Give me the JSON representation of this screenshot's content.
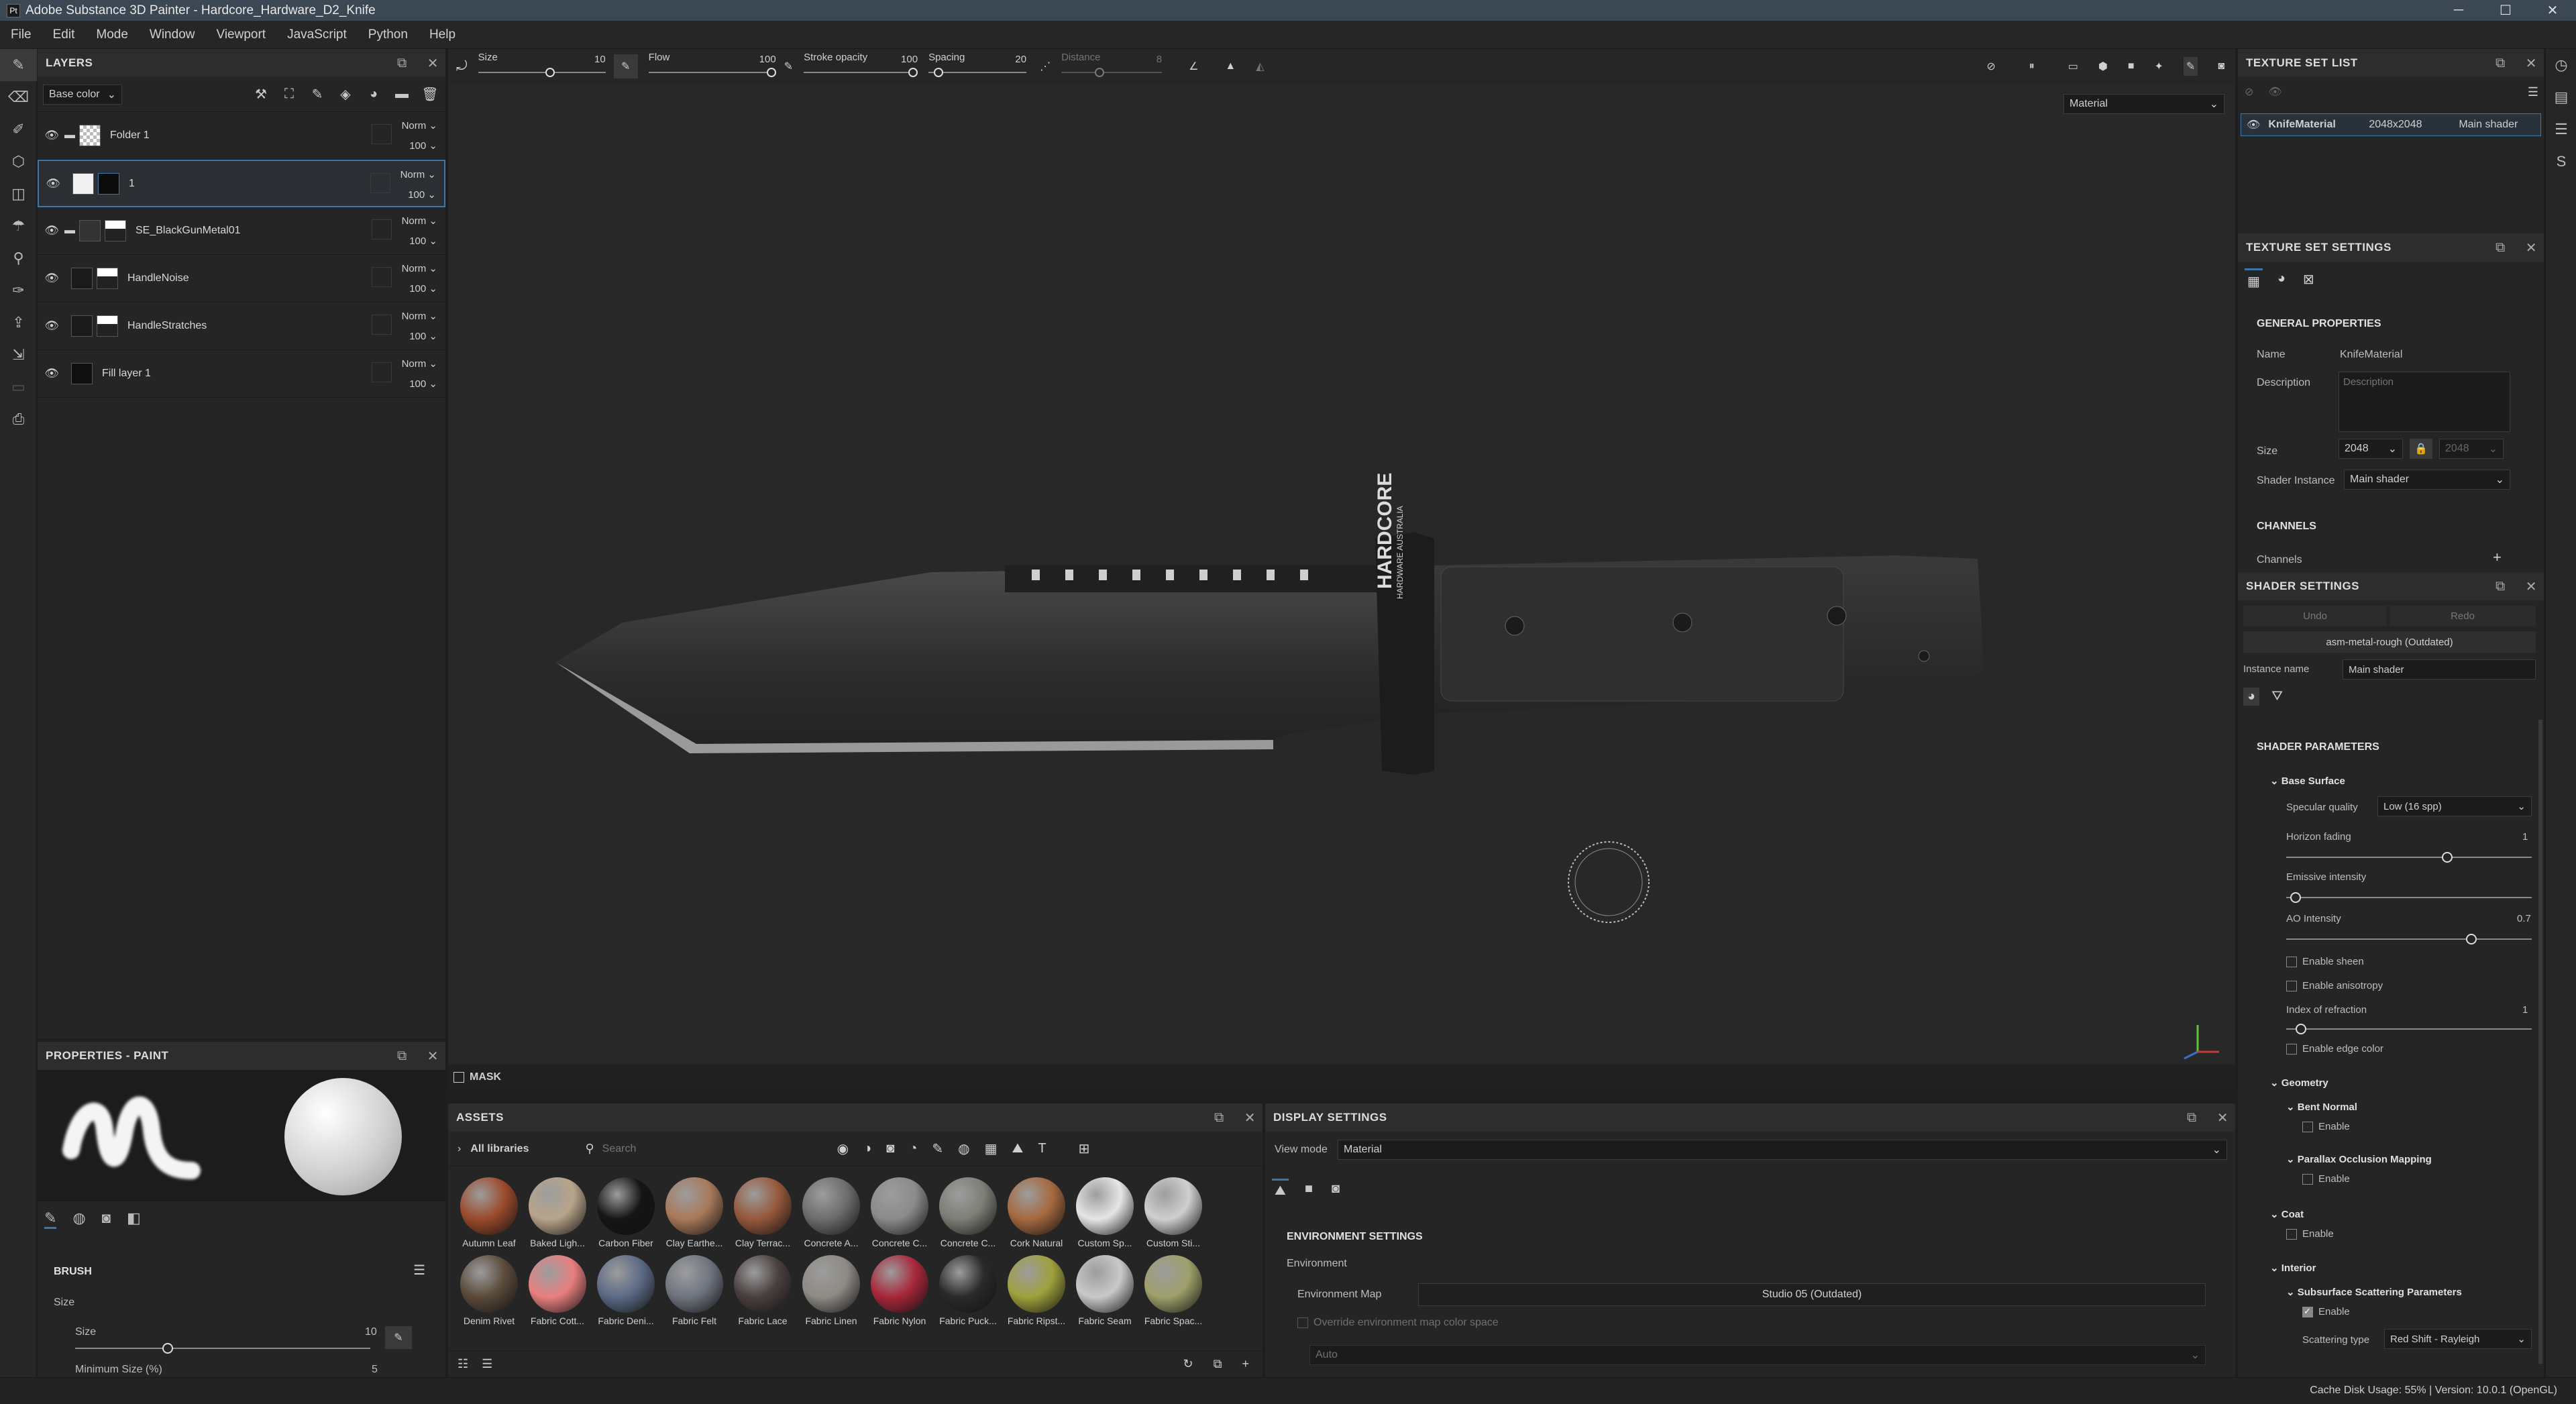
{
  "window": {
    "title": "Adobe Substance 3D Painter - Hardcore_Hardware_D2_Knife",
    "min": "─",
    "max": "☐",
    "close": "✕"
  },
  "menu": [
    "File",
    "Edit",
    "Mode",
    "Window",
    "Viewport",
    "JavaScript",
    "Python",
    "Help"
  ],
  "toolbar": {
    "size_label": "Size",
    "size_value": "10",
    "flow_label": "Flow",
    "flow_value": "100",
    "stroke_opacity_label": "Stroke opacity",
    "stroke_opacity_value": "100",
    "spacing_label": "Spacing",
    "spacing_value": "20",
    "distance_label": "Distance",
    "distance_value": "8",
    "view_select": "Material"
  },
  "layers": {
    "title": "LAYERS",
    "channel": "Base color",
    "rows": [
      {
        "name": "Folder 1",
        "blend": "Norm",
        "opacity": "100"
      },
      {
        "name": "1",
        "blend": "Norm",
        "opacity": "100"
      },
      {
        "name": "SE_BlackGunMetal01",
        "blend": "Norm",
        "opacity": "100"
      },
      {
        "name": "HandleNoise",
        "blend": "Norm",
        "opacity": "100"
      },
      {
        "name": "HandleStratches",
        "blend": "Norm",
        "opacity": "100"
      },
      {
        "name": "Fill layer 1",
        "blend": "Norm",
        "opacity": "100"
      }
    ]
  },
  "properties": {
    "title": "PROPERTIES - PAINT",
    "brush_title": "BRUSH",
    "size_group": "Size",
    "size_label": "Size",
    "size_value": "10",
    "min_size_label": "Minimum Size (%)",
    "min_size_value": "5"
  },
  "mask": {
    "label": "MASK"
  },
  "assets": {
    "title": "ASSETS",
    "library": "All libraries",
    "search_placeholder": "Search",
    "materials": [
      {
        "name": "Autumn Leaf",
        "color": "#9b4a2c"
      },
      {
        "name": "Baked Ligh...",
        "color": "#b8a48a"
      },
      {
        "name": "Carbon Fiber",
        "color": "#151515"
      },
      {
        "name": "Clay Earthe...",
        "color": "#a8795a"
      },
      {
        "name": "Clay Terrac...",
        "color": "#96583b"
      },
      {
        "name": "Concrete A...",
        "color": "#6d6d6d"
      },
      {
        "name": "Concrete C...",
        "color": "#8b8b8b"
      },
      {
        "name": "Concrete C...",
        "color": "#7e7e76"
      },
      {
        "name": "Cork Natural",
        "color": "#a6693f"
      },
      {
        "name": "Custom Sp...",
        "color": "#e6e6e6"
      },
      {
        "name": "Custom Sti...",
        "color": "#cfcfcf"
      },
      {
        "name": "Denim Rivet",
        "color": "#5a4a3a"
      },
      {
        "name": "Fabric Cott...",
        "color": "#e87f7f"
      },
      {
        "name": "Fabric Deni...",
        "color": "#5b6a85"
      },
      {
        "name": "Fabric Felt",
        "color": "#6f7580"
      },
      {
        "name": "Fabric Lace",
        "color": "#4a3f3f"
      },
      {
        "name": "Fabric Linen",
        "color": "#8e8a84"
      },
      {
        "name": "Fabric Nylon",
        "color": "#a8273a"
      },
      {
        "name": "Fabric Puck...",
        "color": "#2a2a2a"
      },
      {
        "name": "Fabric Ripst...",
        "color": "#9fa03c"
      },
      {
        "name": "Fabric Seam",
        "color": "#c9c9c9"
      },
      {
        "name": "Fabric Spac...",
        "color": "#9ea06a"
      }
    ]
  },
  "display": {
    "title": "DISPLAY SETTINGS",
    "view_mode_label": "View mode",
    "view_mode": "Material",
    "env_title": "ENVIRONMENT SETTINGS",
    "env_label": "Environment",
    "env_map_label": "Environment Map",
    "env_map_value": "Studio 05 (Outdated)",
    "override_label": "Override environment map color space",
    "auto_value": "Auto"
  },
  "texture_set_list": {
    "title": "TEXTURE SET LIST",
    "item_name": "KnifeMaterial",
    "item_size": "2048x2048",
    "item_shader": "Main shader"
  },
  "texture_set_settings": {
    "title": "TEXTURE SET SETTINGS",
    "general": "GENERAL PROPERTIES",
    "name_label": "Name",
    "name_value": "KnifeMaterial",
    "desc_label": "Description",
    "desc_placeholder": "Description",
    "size_label": "Size",
    "size_value": "2048",
    "size_value2": "2048",
    "shader_instance_label": "Shader Instance",
    "shader_instance_value": "Main shader",
    "channels_title": "CHANNELS",
    "channels_label": "Channels"
  },
  "shader_settings": {
    "title": "SHADER SETTINGS",
    "undo": "Undo",
    "redo": "Redo",
    "shader_name": "asm-metal-rough (Outdated)",
    "instance_label": "Instance name",
    "instance_value": "Main shader",
    "params_title": "SHADER PARAMETERS",
    "base_surface": "Base Surface",
    "specular_label": "Specular quality",
    "specular_value": "Low (16 spp)",
    "horizon_label": "Horizon fading",
    "horizon_value": "1",
    "emissive_label": "Emissive intensity",
    "ao_label": "AO Intensity",
    "ao_value": "0.7",
    "sheen_label": "Enable sheen",
    "aniso_label": "Enable anisotropy",
    "ior_label": "Index of refraction",
    "ior_value": "1",
    "edge_label": "Enable edge color",
    "geometry": "Geometry",
    "bent_normal": "Bent Normal",
    "pom": "Parallax Occlusion Mapping",
    "coat": "Coat",
    "interior": "Interior",
    "sss": "Subsurface Scattering Parameters",
    "enable": "Enable",
    "scatter_label": "Scattering type",
    "scatter_value": "Red Shift - Rayleigh"
  },
  "knife_brand": {
    "line1": "HARDCORE",
    "line2": "HARDWARE AUSTRALIA"
  },
  "status": {
    "text": "Cache Disk Usage:   55% | Version: 10.0.1 (OpenGL)"
  }
}
